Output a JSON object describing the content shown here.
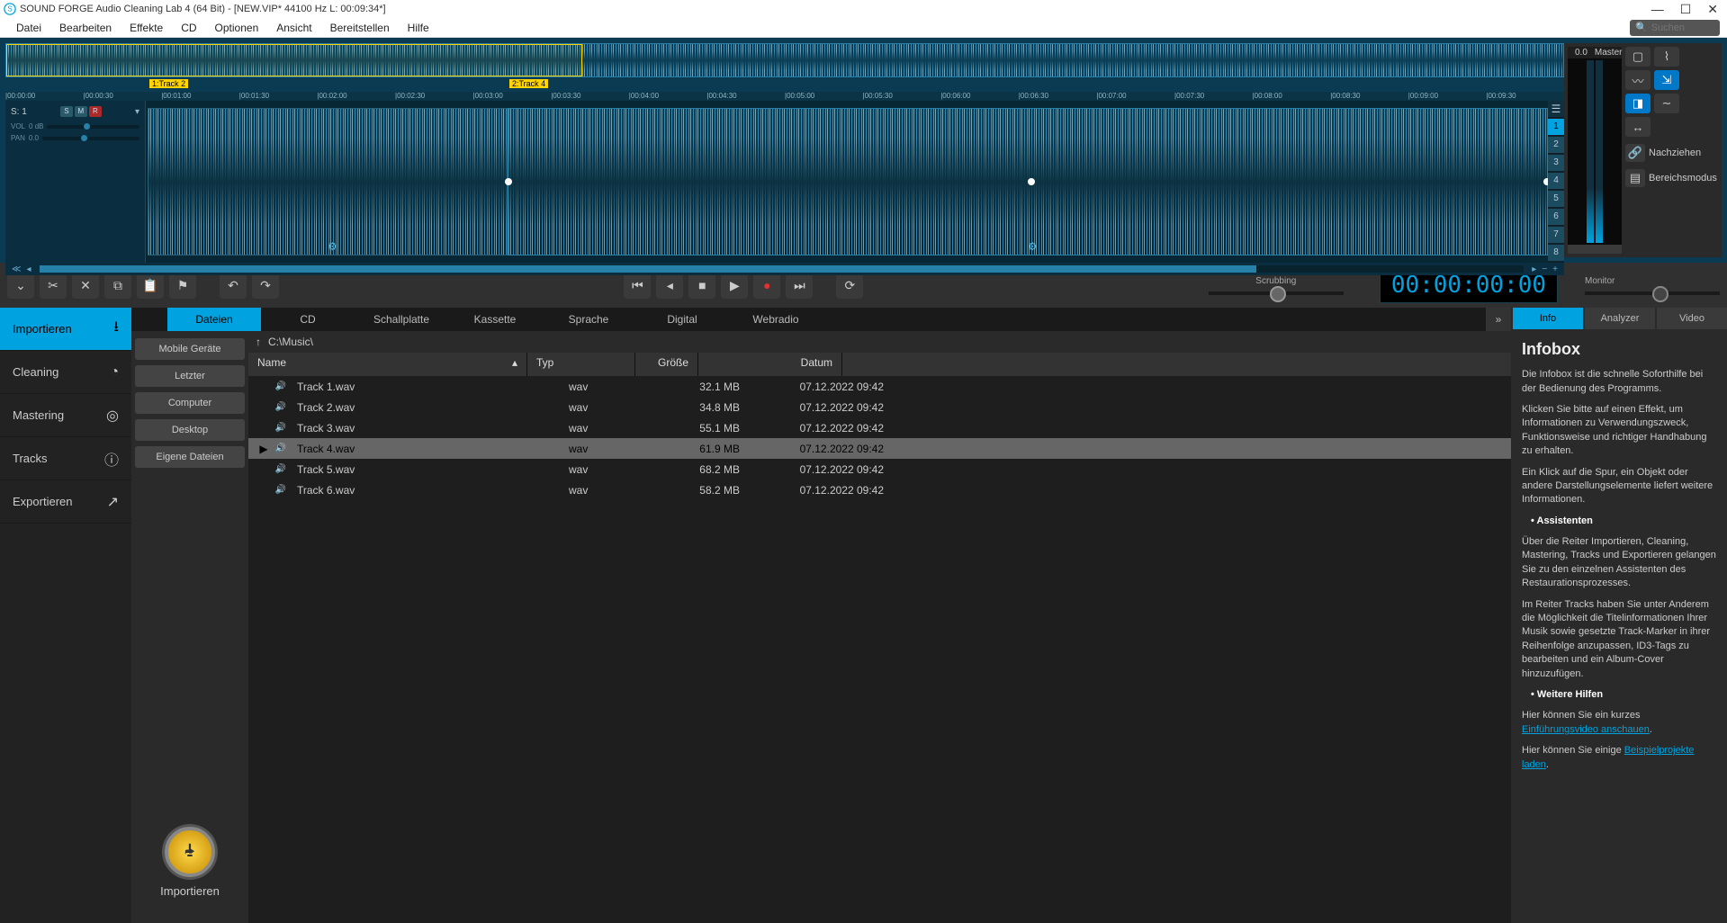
{
  "window": {
    "title": "SOUND FORGE Audio Cleaning Lab 4 (64 Bit) - [NEW.VIP*  44100 Hz L: 00:09:34*]"
  },
  "menu": {
    "items": [
      "Datei",
      "Bearbeiten",
      "Effekte",
      "CD",
      "Optionen",
      "Ansicht",
      "Bereitstellen",
      "Hilfe"
    ],
    "search_placeholder": "Suchen"
  },
  "tracks": {
    "marker1": "1:Track 2",
    "marker2": "2:Track 4",
    "track_label": "S: 1",
    "vol_label": "VOL",
    "vol_value": "0 dB",
    "pan_label": "PAN",
    "pan_value": "0.0",
    "smr": [
      "S",
      "M",
      "R"
    ],
    "side_numbers": [
      "1",
      "2",
      "3",
      "4",
      "5",
      "6",
      "7",
      "8"
    ],
    "timeline": [
      "00:00:00",
      "00:00:30",
      "00:01:00",
      "00:01:30",
      "00:02:00",
      "00:02:30",
      "00:03:00",
      "00:03:30",
      "00:04:00",
      "00:04:30",
      "00:05:00",
      "00:05:30",
      "00:06:00",
      "00:06:30",
      "00:07:00",
      "00:07:30",
      "00:08:00",
      "00:08:30",
      "00:09:00",
      "00:09:30"
    ]
  },
  "meters": {
    "label_00": "0.0",
    "label_master": "Master",
    "link_label": "Nachziehen",
    "range_label": "Bereichsmodus"
  },
  "toolbar": {
    "scrub_label": "Scrubbing",
    "time": "00:00:00:00",
    "monitor_label": "Monitor"
  },
  "leftnav": {
    "items": [
      {
        "key": "import",
        "label": "Importieren"
      },
      {
        "key": "cleaning",
        "label": "Cleaning"
      },
      {
        "key": "mastering",
        "label": "Mastering"
      },
      {
        "key": "tracks",
        "label": "Tracks"
      },
      {
        "key": "export",
        "label": "Exportieren"
      }
    ]
  },
  "tabs": [
    "Dateien",
    "CD",
    "Schallplatte",
    "Kassette",
    "Sprache",
    "Digital",
    "Webradio"
  ],
  "browser": {
    "path": "C:\\Music\\",
    "locations": [
      "Mobile Geräte",
      "Letzter",
      "Computer",
      "Desktop",
      "Eigene Dateien"
    ],
    "import_btn": "Importieren",
    "columns": {
      "name": "Name",
      "typ": "Typ",
      "size": "Größe",
      "date": "Datum"
    },
    "files": [
      {
        "name": "Track 1.wav",
        "typ": "wav",
        "size": "32.1 MB",
        "date": "07.12.2022 09:42"
      },
      {
        "name": "Track 2.wav",
        "typ": "wav",
        "size": "34.8 MB",
        "date": "07.12.2022 09:42"
      },
      {
        "name": "Track 3.wav",
        "typ": "wav",
        "size": "55.1 MB",
        "date": "07.12.2022 09:42"
      },
      {
        "name": "Track 4.wav",
        "typ": "wav",
        "size": "61.9 MB",
        "date": "07.12.2022 09:42"
      },
      {
        "name": "Track 5.wav",
        "typ": "wav",
        "size": "68.2 MB",
        "date": "07.12.2022 09:42"
      },
      {
        "name": "Track 6.wav",
        "typ": "wav",
        "size": "58.2 MB",
        "date": "07.12.2022 09:42"
      }
    ],
    "selected_index": 3
  },
  "right_tabs": [
    "Info",
    "Analyzer",
    "Video"
  ],
  "infobox": {
    "title": "Infobox",
    "p1": "Die Infobox ist die schnelle Soforthilfe bei der Bedienung des Programms.",
    "p2": "Klicken Sie bitte auf einen Effekt, um Informationen zu Verwendungszweck, Funktionsweise und richtiger Handhabung zu erhalten.",
    "p3": "Ein Klick auf die Spur, ein Objekt oder andere Darstellungselemente liefert weitere Informationen.",
    "b1": "• Assistenten",
    "p4": "Über die Reiter Importieren, Cleaning, Mastering, Tracks und Exportieren gelangen Sie zu den einzelnen Assistenten des Restaurationsprozesses.",
    "p5": "Im Reiter Tracks haben Sie unter Anderem die Möglichkeit die Titelinformationen Ihrer Musik sowie gesetzte Track-Marker in ihrer Reihenfolge anzupassen, ID3-Tags zu bearbeiten und ein Album-Cover hinzuzufügen.",
    "b2": "• Weitere Hilfen",
    "p6a": "Hier können Sie ein kurzes ",
    "p6link": "Einführungsvideo anschauen",
    "p7a": "Hier können Sie einige ",
    "p7link": "Beispielprojekte laden"
  }
}
